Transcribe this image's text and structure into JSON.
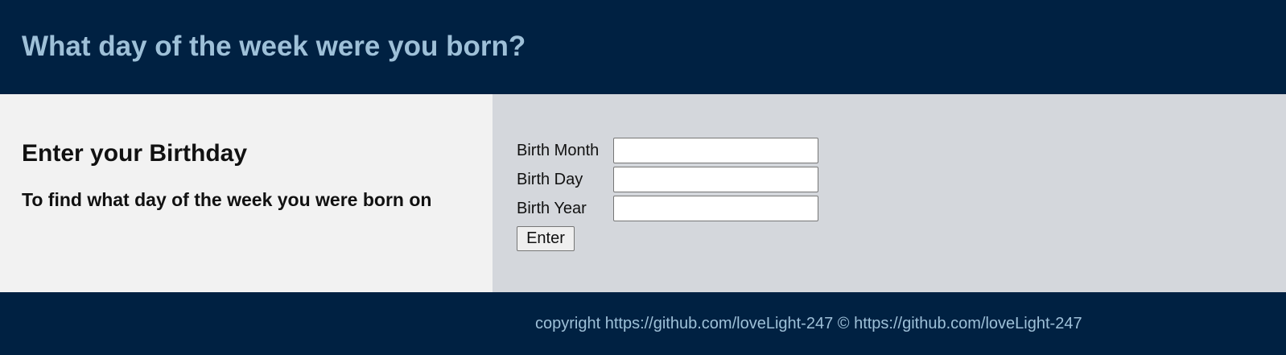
{
  "header": {
    "title": "What day of the week were you born?"
  },
  "intro": {
    "heading": "Enter your Birthday",
    "subheading": "To find what day of the week you were born on"
  },
  "form": {
    "month_label": "Birth Month",
    "month_value": "",
    "day_label": "Birth Day",
    "day_value": "",
    "year_label": "Birth Year",
    "year_value": "",
    "submit_label": "Enter"
  },
  "footer": {
    "text": "copyright https://github.com/loveLight-247 © https://github.com/loveLight-247"
  },
  "colors": {
    "header_bg": "#002142",
    "header_text": "#9ec0d8",
    "left_panel_bg": "#f2f2f2",
    "right_panel_bg": "#d4d7dc"
  }
}
